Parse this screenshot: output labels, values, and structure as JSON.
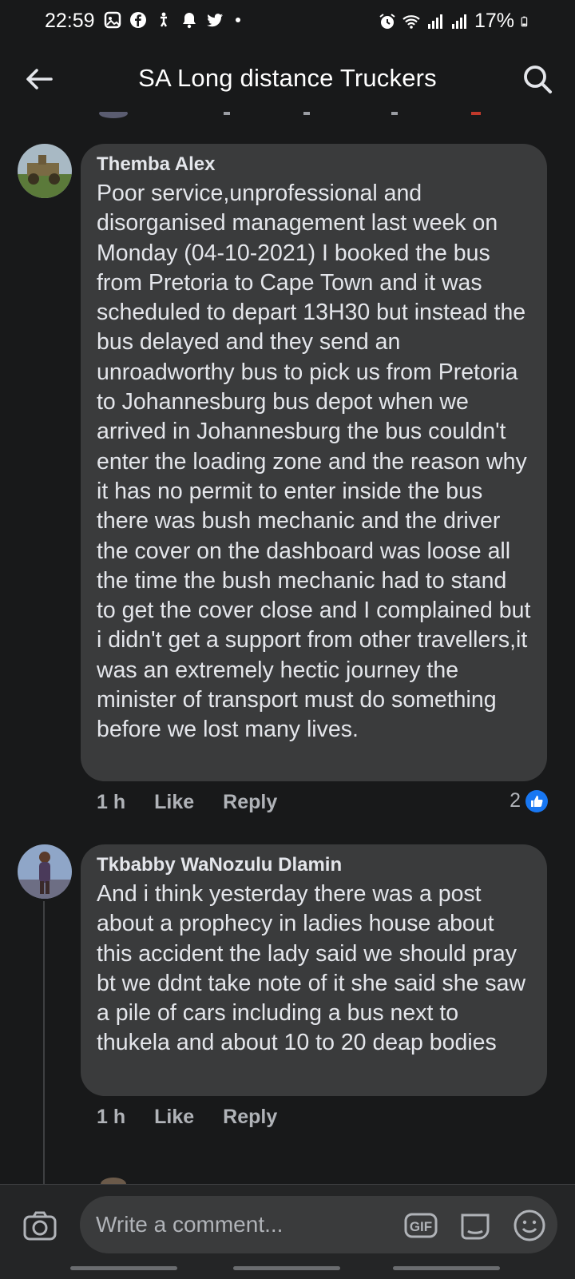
{
  "status": {
    "time": "22:59",
    "battery": "17%",
    "left_icons": [
      "gallery-icon",
      "facebook-icon",
      "accessibility-icon",
      "bell-icon",
      "twitter-icon",
      "dot-icon"
    ],
    "right_icons": [
      "alarm-icon",
      "wifi-icon",
      "signal-icon",
      "signal-icon",
      "battery-icon"
    ]
  },
  "header": {
    "title": "SA Long distance Truckers"
  },
  "comments": [
    {
      "author": "Themba Alex",
      "text": "Poor service,unprofessional and disorganised  management last week on Monday (04-10-2021) I booked the bus from Pretoria to Cape Town and it was scheduled to depart 13H30 but instead the bus delayed and they send an unroadworthy bus to pick us from Pretoria to Johannesburg bus depot when we arrived in Johannesburg the bus couldn't enter the loading zone and the reason why it has no permit to enter inside the bus there was bush mechanic and the driver the cover on the dashboard was loose all the time the bush mechanic had to stand to get the cover close and I complained but i didn't get a support from other travellers,it was an extremely hectic journey the minister of transport must do something before we lost many lives.",
      "time": "1 h",
      "like_label": "Like",
      "reply_label": "Reply",
      "reaction_count": "2"
    },
    {
      "author": "Tkbabby WaNozulu Dlamin",
      "text": "And i think yesterday there was a post about a prophecy in ladies house about this accident the lady said we should pray bt we ddnt take note of it she said she saw a pile of cars including a bus next to thukela and about 10 to 20 deap bodies",
      "time": "1 h",
      "like_label": "Like",
      "reply_label": "Reply"
    }
  ],
  "composer": {
    "placeholder": "Write a comment...",
    "gif_label": "GIF"
  },
  "colors": {
    "background": "#18191a",
    "bubble": "#3a3b3c",
    "text": "#e4e6eb",
    "muted": "#b0b3b8",
    "like_blue": "#1877f2"
  }
}
